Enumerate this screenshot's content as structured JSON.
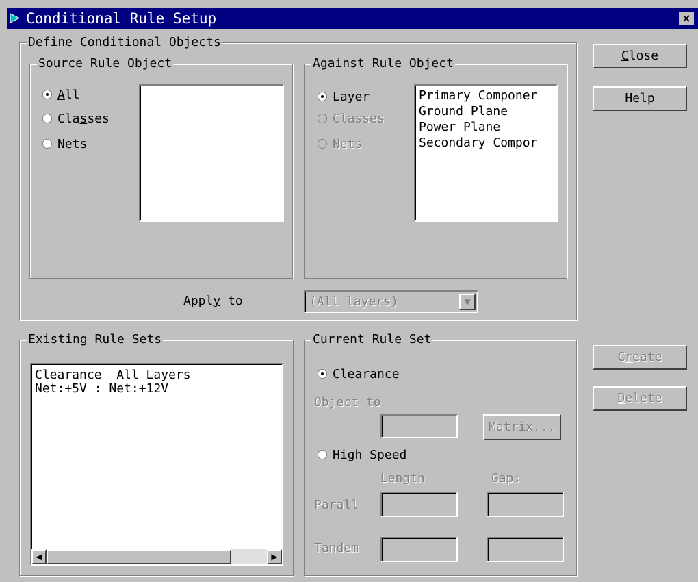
{
  "window": {
    "title": "Conditional Rule Setup",
    "close_glyph": "×"
  },
  "buttons": {
    "close_key": "C",
    "close_rest": "lose",
    "help_key": "H",
    "help_rest": "elp",
    "create_pre": "C",
    "create_key": "r",
    "create_rest": "eate",
    "delete_key": "D",
    "delete_rest": "elete"
  },
  "define": {
    "legend": "Define Conditional Objects",
    "source": {
      "legend": "Source Rule Object",
      "options": [
        {
          "key": "A",
          "rest": "ll",
          "selected": true
        },
        {
          "pre": "Cla",
          "key": "s",
          "rest": "ses",
          "selected": false
        },
        {
          "key": "N",
          "rest": "ets",
          "selected": false
        }
      ]
    },
    "against": {
      "legend": "Against Rule Object",
      "options": [
        {
          "label": "Layer",
          "selected": true
        },
        {
          "label": "Classes",
          "selected": false
        },
        {
          "label": "Nets",
          "selected": false
        }
      ],
      "list_items": [
        "Primary Componer",
        "Ground Plane",
        "Power Plane",
        "Secondary Compor"
      ]
    },
    "apply_to": {
      "label_pre": "Appl",
      "label_key": "y",
      "label_rest": " to",
      "value": "(All layers)"
    }
  },
  "existing": {
    "legend": "Existing Rule Sets",
    "lines": [
      "Clearance  All Layers",
      "Net:+5V : Net:+12V"
    ]
  },
  "current": {
    "legend": "Current Rule Set",
    "clearance_label": "Clearance",
    "object_to_label": "Object to",
    "matrix_button": "Matrix...",
    "high_speed_label": "High Speed",
    "length_label": "Length",
    "gap_label": "Gap:",
    "parallel_label": "Parall",
    "tandem_label": "Tandem"
  }
}
